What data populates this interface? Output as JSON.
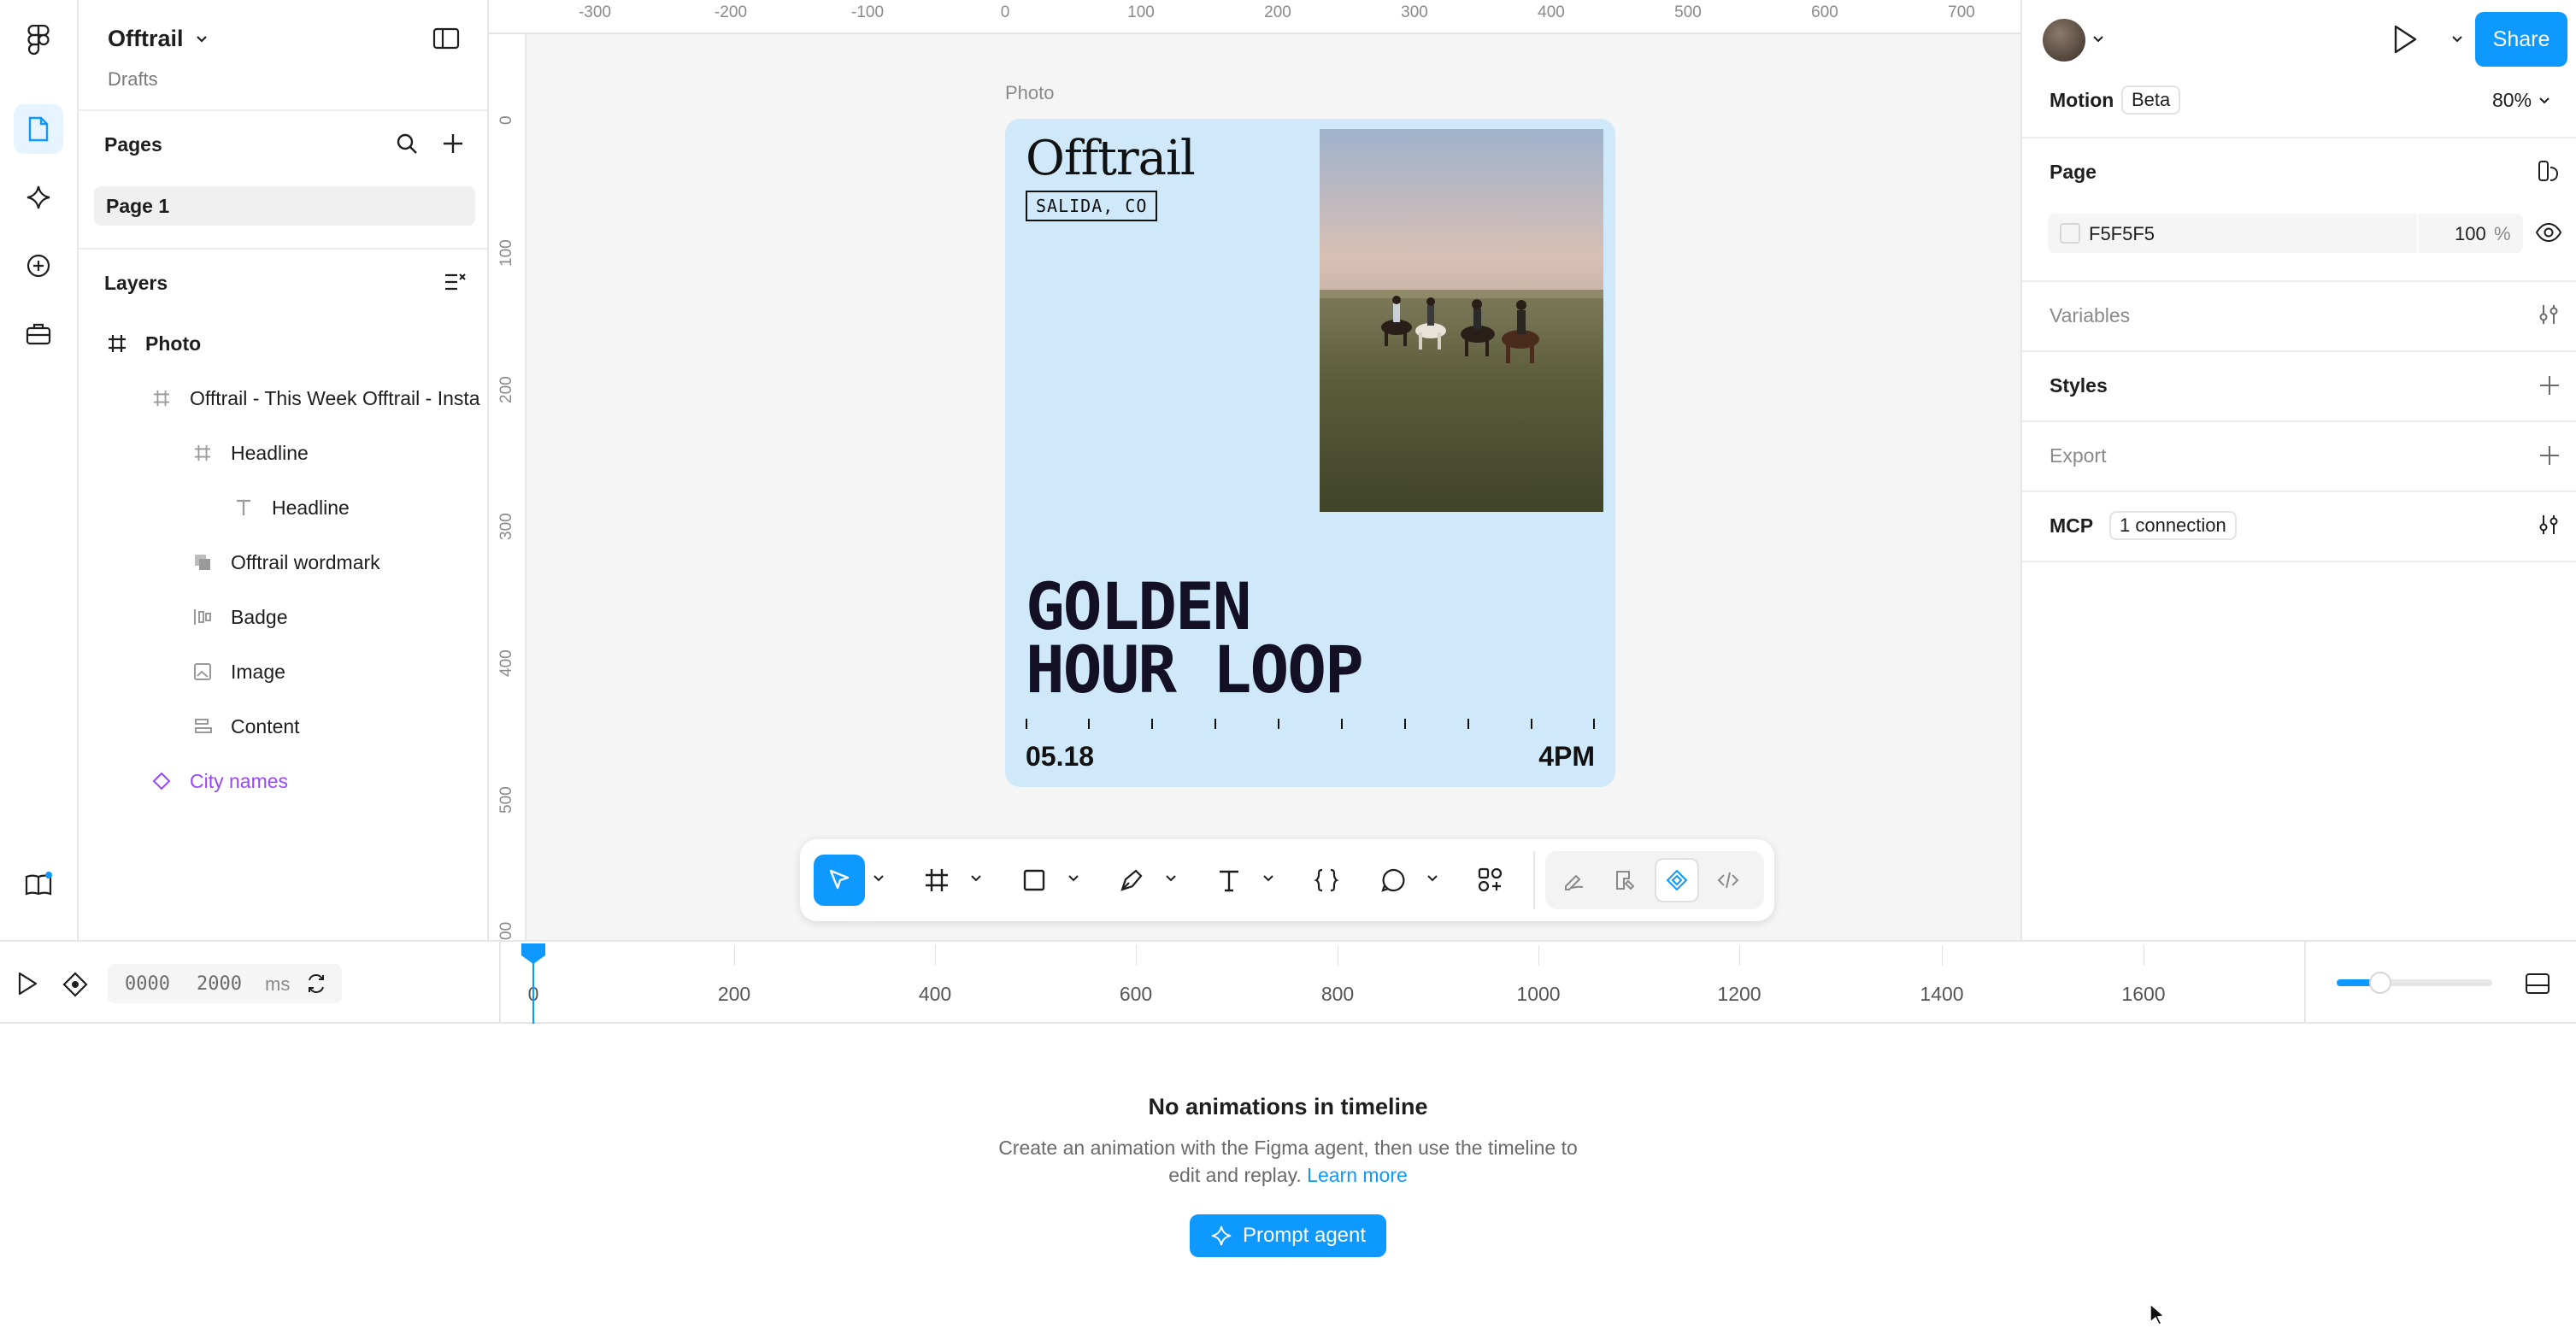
{
  "file": {
    "name": "Offtrail",
    "location": "Drafts"
  },
  "pages": {
    "title": "Pages",
    "items": [
      "Page 1"
    ]
  },
  "layers": {
    "title": "Layers",
    "items": [
      {
        "label": "Photo",
        "type": "frame"
      },
      {
        "label": "Offtrail - This Week Offtrail - Insta",
        "type": "frame"
      },
      {
        "label": "Headline",
        "type": "frame"
      },
      {
        "label": "Headline",
        "type": "text"
      },
      {
        "label": "Offtrail wordmark",
        "type": "group"
      },
      {
        "label": "Badge",
        "type": "autolayout"
      },
      {
        "label": "Image",
        "type": "image"
      },
      {
        "label": "Content",
        "type": "autolayout"
      },
      {
        "label": "City names",
        "type": "component"
      }
    ]
  },
  "rulers": {
    "top": [
      "-300",
      "-200",
      "-100",
      "0",
      "100",
      "200",
      "300",
      "400",
      "500",
      "600",
      "700"
    ],
    "left": [
      "0",
      "100",
      "200",
      "300",
      "400",
      "500",
      "00"
    ]
  },
  "frame": {
    "label": "Photo",
    "wordmark": "Offtrail",
    "city": "SALIDA, CO",
    "headline_line1": "GOLDEN",
    "headline_line2": "HOUR LOOP",
    "date": "05.18",
    "time": "4PM",
    "background": "#CFE9FB"
  },
  "right_panel": {
    "motion_label": "Motion",
    "beta_label": "Beta",
    "zoom": "80%",
    "share_label": "Share",
    "page_title": "Page",
    "page_color": "F5F5F5",
    "page_opacity": "100",
    "page_opacity_unit": "%",
    "variables_label": "Variables",
    "styles_label": "Styles",
    "export_label": "Export",
    "mcp_label": "MCP",
    "mcp_connections": "1 connection"
  },
  "timeline": {
    "start": "0000",
    "end": "2000",
    "unit": "ms",
    "marks": [
      "0",
      "200",
      "400",
      "600",
      "800",
      "1000",
      "1200",
      "1400",
      "1600"
    ],
    "empty_title": "No animations in timeline",
    "empty_desc_line1": "Create an animation with the Figma agent, then use the timeline to",
    "empty_desc_line2": "edit and replay.",
    "learn_more": "Learn more",
    "prompt_button": "Prompt agent",
    "zoom_slider_value": 0.28
  },
  "colors": {
    "accent": "#0D99FF",
    "component": "#9747FF",
    "canvas": "#F5F5F5"
  }
}
